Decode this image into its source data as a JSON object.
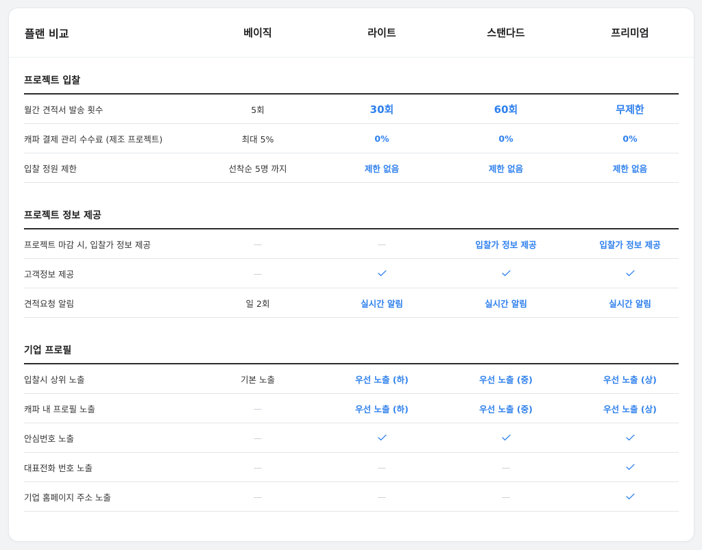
{
  "header": {
    "title": "플랜 비교",
    "plans": [
      "베이직",
      "라이트",
      "스탠다드",
      "프리미엄"
    ]
  },
  "colors": {
    "accent": "#2f80ed",
    "dash": "#c7cbd1"
  },
  "dash_symbol": "—",
  "sections": [
    {
      "title": "프로젝트 입찰",
      "rows": [
        {
          "label": "월간 견적서 발송 횟수",
          "values": [
            "5회",
            "30회",
            "60회",
            "무제한"
          ]
        },
        {
          "label": "캐파 결제 관리 수수료 (제조 프로젝트)",
          "values": [
            "최대 5%",
            "0%",
            "0%",
            "0%"
          ]
        },
        {
          "label": "입찰 정원 제한",
          "values": [
            "선착순 5명 까지",
            "제한 없음",
            "제한 없음",
            "제한 없음"
          ]
        }
      ]
    },
    {
      "title": "프로젝트 정보 제공",
      "rows": [
        {
          "label": "프로젝트 마감 시, 입찰가 정보 제공",
          "values": [
            "—",
            "—",
            "입찰가 정보 제공",
            "입찰가 정보 제공"
          ]
        },
        {
          "label": "고객정보 제공",
          "values": [
            "—",
            "check",
            "check",
            "check"
          ]
        },
        {
          "label": "견적요청 알림",
          "values": [
            "일 2회",
            "실시간 알림",
            "실시간 알림",
            "실시간 알림"
          ]
        }
      ]
    },
    {
      "title": "기업 프로필",
      "rows": [
        {
          "label": "입찰시 상위 노출",
          "values": [
            "기본 노출",
            "우선 노출 (하)",
            "우선 노출 (중)",
            "우선 노출 (상)"
          ]
        },
        {
          "label": "캐파 내 프로필 노출",
          "values": [
            "—",
            "우선 노출 (하)",
            "우선 노출 (중)",
            "우선 노출 (상)"
          ]
        },
        {
          "label": "안심번호 노출",
          "values": [
            "—",
            "check",
            "check",
            "check"
          ]
        },
        {
          "label": "대표전화 번호 노출",
          "values": [
            "—",
            "—",
            "—",
            "check"
          ]
        },
        {
          "label": "기업 홈페이지 주소 노출",
          "values": [
            "—",
            "—",
            "—",
            "check"
          ]
        }
      ]
    }
  ]
}
